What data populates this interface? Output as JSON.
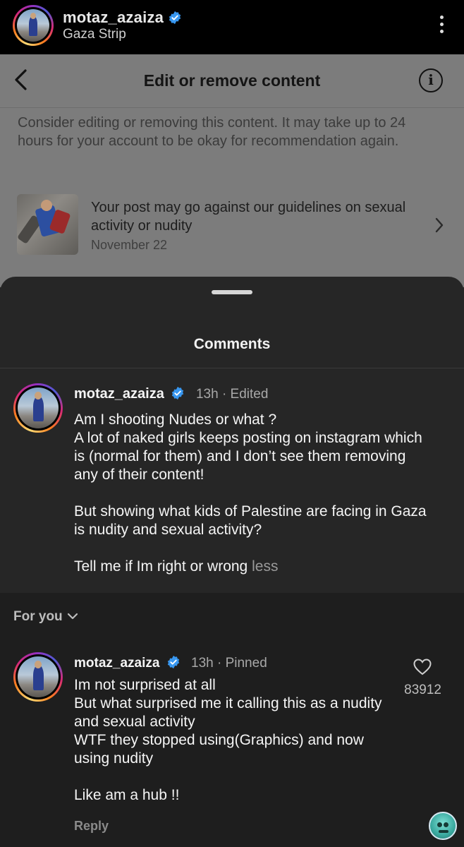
{
  "top_bar": {
    "username": "motaz_azaiza",
    "location": "Gaza Strip"
  },
  "edit_screen": {
    "title": "Edit or remove content",
    "description": "Consider editing or removing this content. It may take up to 24 hours for your account to be okay for recommendation again.",
    "notice": {
      "text": "Your post may go against our guidelines on sexual activity or nudity",
      "date": "November 22"
    }
  },
  "comments_sheet": {
    "title": "Comments",
    "caption": {
      "username": "motaz_azaiza",
      "meta": "13h · Edited",
      "body": "Am I shooting Nudes or what ?\nA lot of naked girls keeps posting on instagram which is (normal for them) and I don’t see them removing any of their content!\n\nBut showing what kids of Palestine are facing in Gaza is nudity and sexual activity?\n\nTell me if Im right or wrong",
      "less_label": "less"
    },
    "sort_label": "For you",
    "pinned_comment": {
      "username": "motaz_azaiza",
      "meta": "13h · Pinned",
      "body": "Im not surprised at all\nBut what surprised me it calling this as a nudity and sexual activity\nWTF they stopped using(Graphics) and now using nudity\n\nLike am a hub !!",
      "likes": "83912",
      "reply_label": "Reply"
    }
  },
  "colors": {
    "verified_blue": "#3897f0",
    "sheet_bg": "#262626",
    "dim_overlay": "#7c7c7c"
  }
}
